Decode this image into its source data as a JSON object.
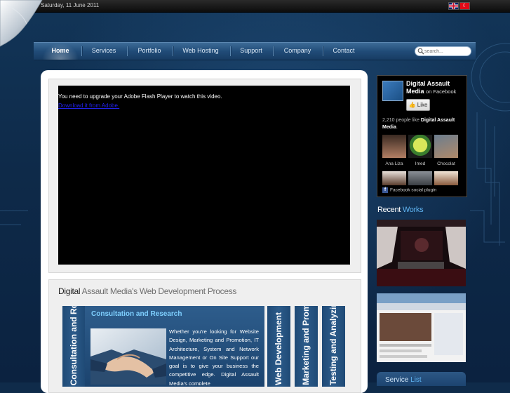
{
  "topbar": {
    "date": "Saturday, 11 June 2011",
    "languages": [
      "English",
      "Türkçe"
    ]
  },
  "nav": {
    "items": [
      "Home",
      "Services",
      "Portfolio",
      "Web Hosting",
      "Support",
      "Company",
      "Contact"
    ],
    "active": "Home",
    "search_placeholder": "search..."
  },
  "video": {
    "message": "You need to upgrade your Adobe Flash Player to watch this video.",
    "link": "Download it from Adobe."
  },
  "process": {
    "title_strong": "Digital",
    "title_rest": " Assault Media's Web Development Process",
    "main_strip_label": "Consultation and Research",
    "main_strip_title": "Consultation and Research",
    "description": "Whether you're looking for Website Design, Marketing and Promotion, IT Architecture, System and Network Management or On Site Support our goal is to give your business the competitive edge. Digital Assault Media's complete",
    "strips": [
      "Web Development",
      "Marketing and Promotion",
      "Testing and Analyzing"
    ]
  },
  "facebook": {
    "page_name": "Digital Assault Media",
    "on_text": "on Facebook",
    "like_label": "Like",
    "count_text": "2,210 people like",
    "count_page": "Digital Assault Media",
    "faces": [
      "Ana Liza",
      "Imed",
      "Chocolat"
    ],
    "plugin_label": "Facebook social plugin"
  },
  "recent": {
    "title_strong": "Recent",
    "title_rest": " Works"
  },
  "services": {
    "title_strong": "Service",
    "title_rest": " List"
  },
  "colors": {
    "accent": "#5fb4f2",
    "nav_bg": "#214c78",
    "page_bg": "#0f2b4a"
  }
}
